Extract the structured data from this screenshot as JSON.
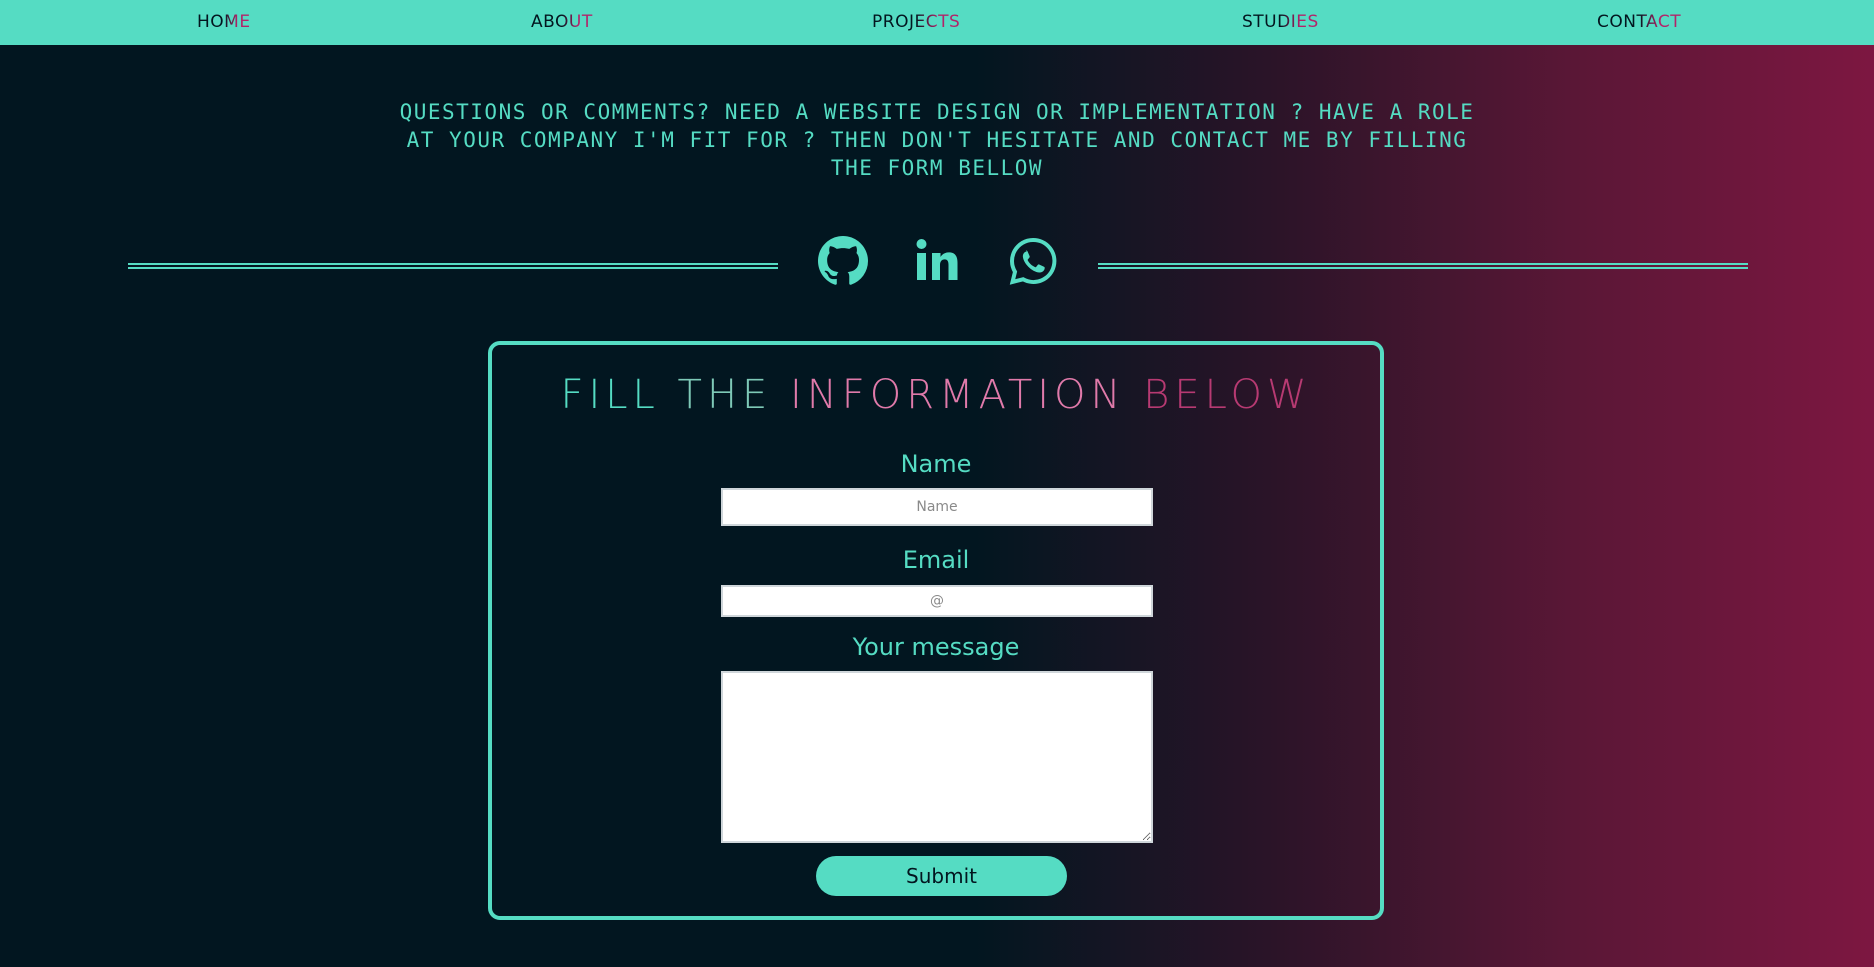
{
  "nav": {
    "items": [
      {
        "label": "HOME"
      },
      {
        "label": "ABOUT"
      },
      {
        "label": "PROJECTS"
      },
      {
        "label": "STUDIES"
      },
      {
        "label": "CONTACT"
      }
    ]
  },
  "intro": {
    "text": "QUESTIONS OR COMMENTS? NEED A WEBSITE DESIGN OR IMPLEMENTATION ? HAVE A ROLE AT YOUR COMPANY I'M FIT  FOR ? THEN DON'T HESITATE AND CONTACT ME BY FILLING THE   FORM BELLOW"
  },
  "social": {
    "icons": [
      "github-icon",
      "linkedin-icon",
      "whatsapp-icon"
    ]
  },
  "form": {
    "title_parts": [
      "FILL",
      "THE",
      "INFORMATION",
      "BELOW"
    ],
    "name_label": "Name",
    "name_placeholder": "Name",
    "email_label": "Email",
    "email_placeholder": "@",
    "message_label": "Your message",
    "message_value": "",
    "submit_label": "Submit"
  },
  "colors": {
    "accent": "#55dcc3",
    "background_dark": "#021620",
    "background_magenta": "#7d1741",
    "highlight_pink": "#b2246a"
  }
}
